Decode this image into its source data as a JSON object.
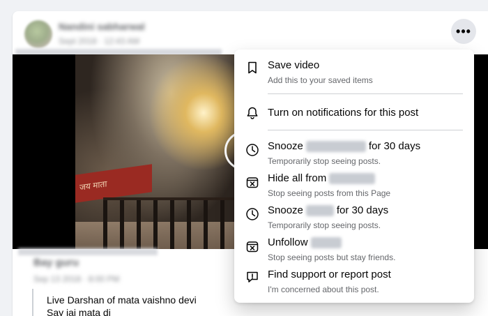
{
  "post": {
    "author_name": "Nandini sabharwal",
    "meta": "Sept 2018 · 12:43 AM",
    "more_icon": "more-horizontal-icon",
    "shared_author": "Bay guru",
    "shared_meta": "Sep 13 2018 · 8:00 PM",
    "video_board_text": "जय माता",
    "caption_lines": [
      "Live Darshan of mata vaishno devi",
      "Say jai mata di"
    ]
  },
  "menu": {
    "items": [
      {
        "icon": "bookmark-icon",
        "title": "Save video",
        "subtitle": "Add this to your saved items"
      },
      {
        "icon": "bell-icon",
        "title": "Turn on notifications for this post",
        "subtitle": ""
      },
      {
        "icon": "clock-icon",
        "title_prefix": "Snooze",
        "title_suffix": "for 30 days",
        "subtitle": "Temporarily stop seeing posts."
      },
      {
        "icon": "hide-box-icon",
        "title_prefix": "Hide all from",
        "title_suffix": "",
        "subtitle": "Stop seeing posts from this Page"
      },
      {
        "icon": "clock-icon",
        "title_prefix": "Snooze",
        "title_suffix": "for 30 days",
        "subtitle": "Temporarily stop seeing posts."
      },
      {
        "icon": "unfollow-box-icon",
        "title_prefix": "Unfollow",
        "title_suffix": "",
        "subtitle": "Stop seeing posts but stay friends."
      },
      {
        "icon": "report-icon",
        "title": "Find support or report post",
        "subtitle": "I'm concerned about this post."
      }
    ]
  }
}
